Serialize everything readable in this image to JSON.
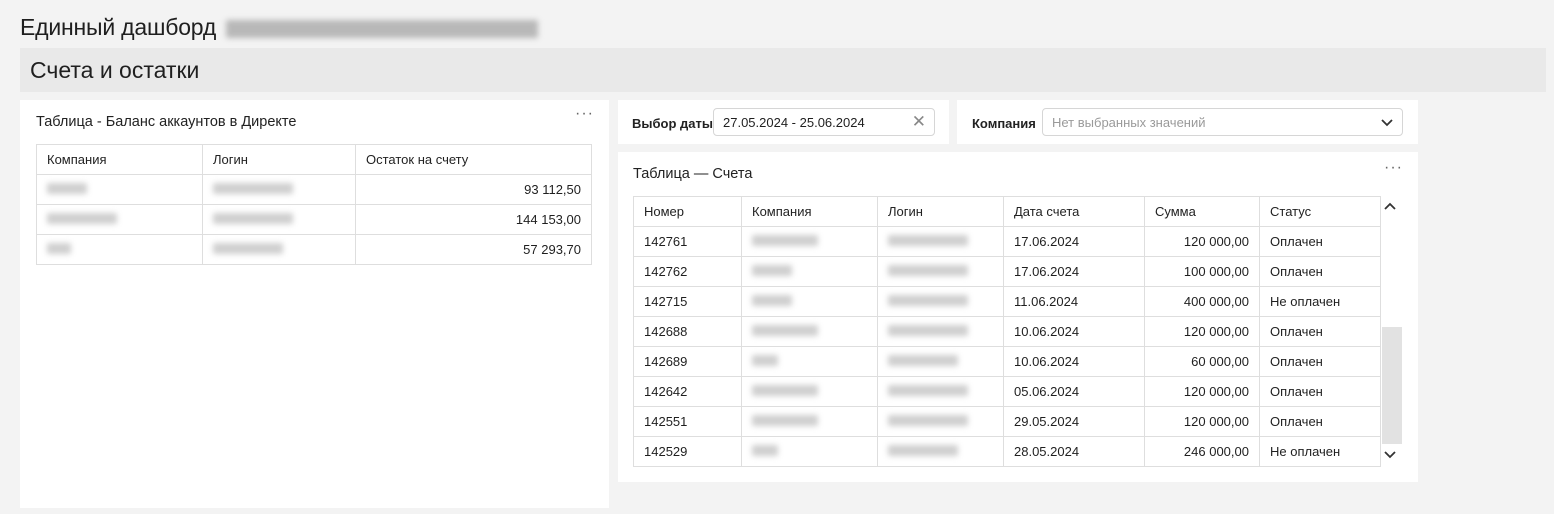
{
  "header": {
    "title": "Единный дашборд"
  },
  "section": {
    "title": "Счета и остатки"
  },
  "balance": {
    "title": "Таблица - Баланс аккаунтов в Директе",
    "columns": [
      "Компания",
      "Логин",
      "Остаток на счету"
    ],
    "rows": [
      {
        "balance": "93 112,50"
      },
      {
        "balance": "144 153,00"
      },
      {
        "balance": "57 293,70"
      }
    ]
  },
  "date_filter": {
    "label": "Выбор даты",
    "value": "27.05.2024 - 25.06.2024"
  },
  "company_filter": {
    "label": "Компания",
    "placeholder": "Нет выбранных значений"
  },
  "invoices": {
    "title": "Таблица — Счета",
    "columns": [
      "Номер",
      "Компания",
      "Логин",
      "Дата счета",
      "Сумма",
      "Статус"
    ],
    "rows": [
      {
        "number": "142761",
        "date": "17.06.2024",
        "amount": "120 000,00",
        "status": "Оплачен"
      },
      {
        "number": "142762",
        "date": "17.06.2024",
        "amount": "100 000,00",
        "status": "Оплачен"
      },
      {
        "number": "142715",
        "date": "11.06.2024",
        "amount": "400 000,00",
        "status": "Не оплачен"
      },
      {
        "number": "142688",
        "date": "10.06.2024",
        "amount": "120 000,00",
        "status": "Оплачен"
      },
      {
        "number": "142689",
        "date": "10.06.2024",
        "amount": "60 000,00",
        "status": "Оплачен"
      },
      {
        "number": "142642",
        "date": "05.06.2024",
        "amount": "120 000,00",
        "status": "Оплачен"
      },
      {
        "number": "142551",
        "date": "29.05.2024",
        "amount": "120 000,00",
        "status": "Оплачен"
      },
      {
        "number": "142529",
        "date": "28.05.2024",
        "amount": "246 000,00",
        "status": "Не оплачен"
      }
    ]
  },
  "icons": {
    "menu": "more-dots-icon",
    "clear": "close-icon",
    "dropdown": "chevron-down-icon",
    "scroll_up": "chevron-up-icon",
    "scroll_down": "chevron-down-icon"
  }
}
